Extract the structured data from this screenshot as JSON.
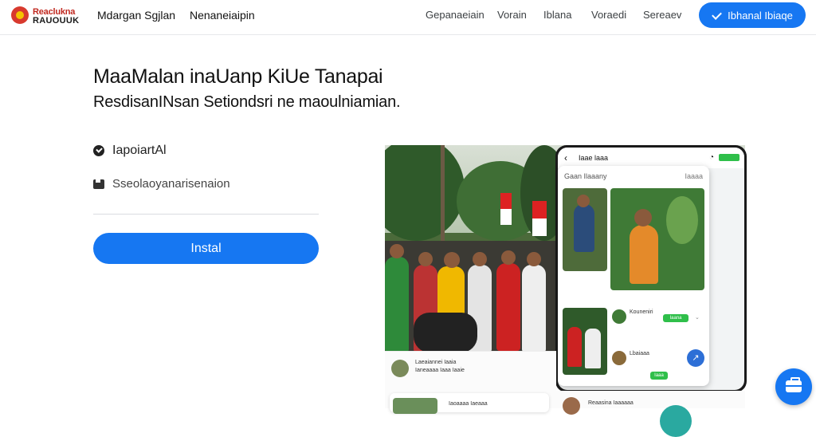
{
  "brand": {
    "logo_line1": "Reaclukna",
    "logo_line2": "RAUOUUK",
    "links": [
      "Mdargan Sgjlan",
      "Nenaneiaipin"
    ]
  },
  "nav": {
    "items": [
      "Gepanaeiain",
      "Vorain",
      "Iblana",
      "Voraedi",
      "Sereaev"
    ],
    "cta_label": "Ibhanal Ibiaqe"
  },
  "hero": {
    "title": "MaaMalan inaUanp KiUe Tanapai",
    "subtitle": "ResdisanINsan Setiondsri ne maoulniamian."
  },
  "features": [
    {
      "label": "IapoiartAl",
      "icon": "check-circle-icon"
    },
    {
      "label": "Sseolaoyanarisenaion",
      "icon": "briefcase-icon"
    }
  ],
  "install_label": "Instal",
  "phone": {
    "time": "Iaae laaa",
    "panel_header": "Gaan Ilaaany",
    "panel_more": "Iaaaa",
    "row1_name": "Kouneniri",
    "row1_tag": "Iaana",
    "row2_name": "Lbaiaaa",
    "row2_tag": "Iaaa"
  },
  "feed": {
    "author": "Laeaiannei Iaaia",
    "meta": "Ianeaaaa Iaaa Iaaie",
    "card_text": "Iaoaaaa Iaeaaa",
    "author2": "Reaasina Iaaaaaa"
  },
  "colors": {
    "accent": "#1677f2",
    "status_green": "#2fbf4a"
  },
  "icons": {
    "cta": "check-icon",
    "chat": "briefcase-icon",
    "share": "share-icon"
  }
}
